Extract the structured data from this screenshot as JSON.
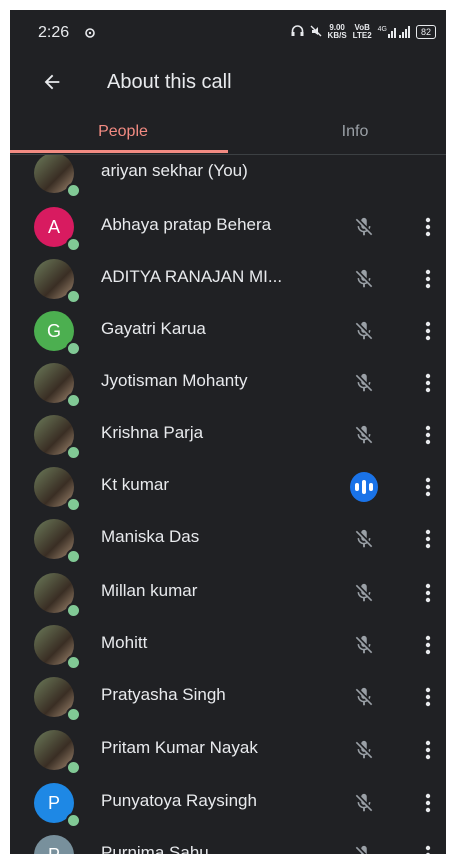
{
  "status_bar": {
    "time": "2:26",
    "speed_value": "9.00",
    "speed_unit": "KB/S",
    "network_1": "VoB",
    "network_2": "LTE2",
    "signal_label": "4G",
    "battery": "82",
    "icons": [
      "cast-icon",
      "headset-icon",
      "mute-icon",
      "signal-icon",
      "battery-icon"
    ]
  },
  "app_bar": {
    "title": "About this call",
    "back_icon": "arrow-back-icon"
  },
  "tabs": [
    {
      "label": "People",
      "selected": true
    },
    {
      "label": "Info",
      "selected": false
    }
  ],
  "colors": {
    "background": "#202124",
    "accent": "#f28b82",
    "presence": "#81c995",
    "speaking": "#1a73e8",
    "text": "#e8eaed",
    "muted_icon": "#9aa0a6"
  },
  "participants": [
    {
      "name": "ariyan sekhar (You)",
      "avatar_type": "photo",
      "initial": "",
      "avatar_color": "",
      "mic": "none"
    },
    {
      "name": "Abhaya pratap Behera",
      "avatar_type": "letter",
      "initial": "A",
      "avatar_color": "#d81b60",
      "mic": "muted"
    },
    {
      "name": "ADITYA RANAJAN MI...",
      "avatar_type": "photo",
      "initial": "",
      "avatar_color": "",
      "mic": "muted"
    },
    {
      "name": "Gayatri Karua",
      "avatar_type": "letter",
      "initial": "G",
      "avatar_color": "#4caf50",
      "mic": "muted"
    },
    {
      "name": "Jyotisman Mohanty",
      "avatar_type": "photo",
      "initial": "",
      "avatar_color": "",
      "mic": "muted"
    },
    {
      "name": "Krishna Parja",
      "avatar_type": "photo",
      "initial": "",
      "avatar_color": "",
      "mic": "muted"
    },
    {
      "name": "Kt kumar",
      "avatar_type": "photo",
      "initial": "",
      "avatar_color": "",
      "mic": "speaking"
    },
    {
      "name": "Maniska Das",
      "avatar_type": "photo",
      "initial": "",
      "avatar_color": "",
      "mic": "muted"
    },
    {
      "name": "Millan kumar",
      "avatar_type": "photo",
      "initial": "",
      "avatar_color": "",
      "mic": "muted"
    },
    {
      "name": "Mohitt",
      "avatar_type": "photo",
      "initial": "",
      "avatar_color": "",
      "mic": "muted"
    },
    {
      "name": "Pratyasha Singh",
      "avatar_type": "photo",
      "initial": "",
      "avatar_color": "",
      "mic": "muted"
    },
    {
      "name": "Pritam Kumar Nayak",
      "avatar_type": "photo",
      "initial": "",
      "avatar_color": "",
      "mic": "muted"
    },
    {
      "name": "Punyatoya Raysingh",
      "avatar_type": "letter",
      "initial": "P",
      "avatar_color": "#1e88e5",
      "mic": "muted"
    },
    {
      "name": "Purnima Sahu",
      "avatar_type": "letter",
      "initial": "P",
      "avatar_color": "#78909c",
      "mic": "muted"
    }
  ]
}
